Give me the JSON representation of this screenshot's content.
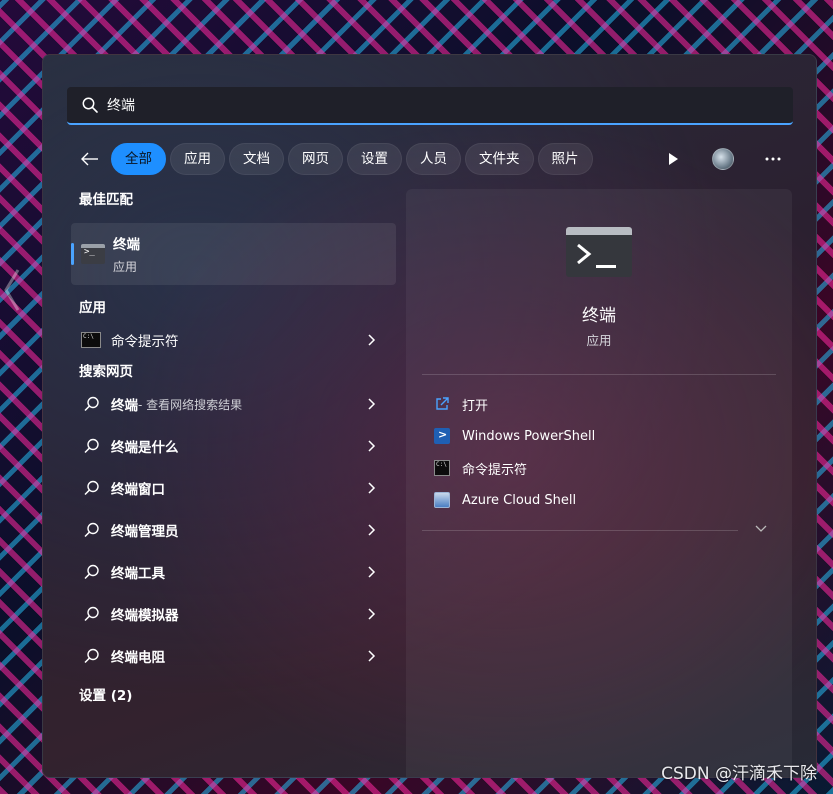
{
  "search": {
    "value": "终端"
  },
  "filters": {
    "tabs": [
      "全部",
      "应用",
      "文档",
      "网页",
      "设置",
      "人员",
      "文件夹",
      "照片"
    ],
    "active_index": 0
  },
  "left": {
    "best_match": {
      "heading": "最佳匹配",
      "title": "终端",
      "subtitle": "应用"
    },
    "apps": {
      "heading": "应用",
      "items": [
        "命令提示符"
      ]
    },
    "web": {
      "heading": "搜索网页",
      "first_bold": "终端",
      "first_rest": " - 查看网络搜索结果",
      "items": [
        "终端是什么",
        "终端窗口",
        "终端管理员",
        "终端工具",
        "终端模拟器",
        "终端电阻"
      ]
    },
    "settings": {
      "heading": "设置 (2)"
    }
  },
  "right": {
    "title": "终端",
    "subtitle": "应用",
    "actions": [
      {
        "label": "打开",
        "icon": "open-external-icon"
      },
      {
        "label": "Windows PowerShell",
        "icon": "powershell-icon"
      },
      {
        "label": "命令提示符",
        "icon": "cmd-icon"
      },
      {
        "label": "Azure Cloud Shell",
        "icon": "azure-cloud-shell-icon"
      }
    ]
  },
  "watermark": "CSDN @汗滴禾下除",
  "colors": {
    "accent": "#1e8fff",
    "focus_underline": "#4aa3ff"
  }
}
